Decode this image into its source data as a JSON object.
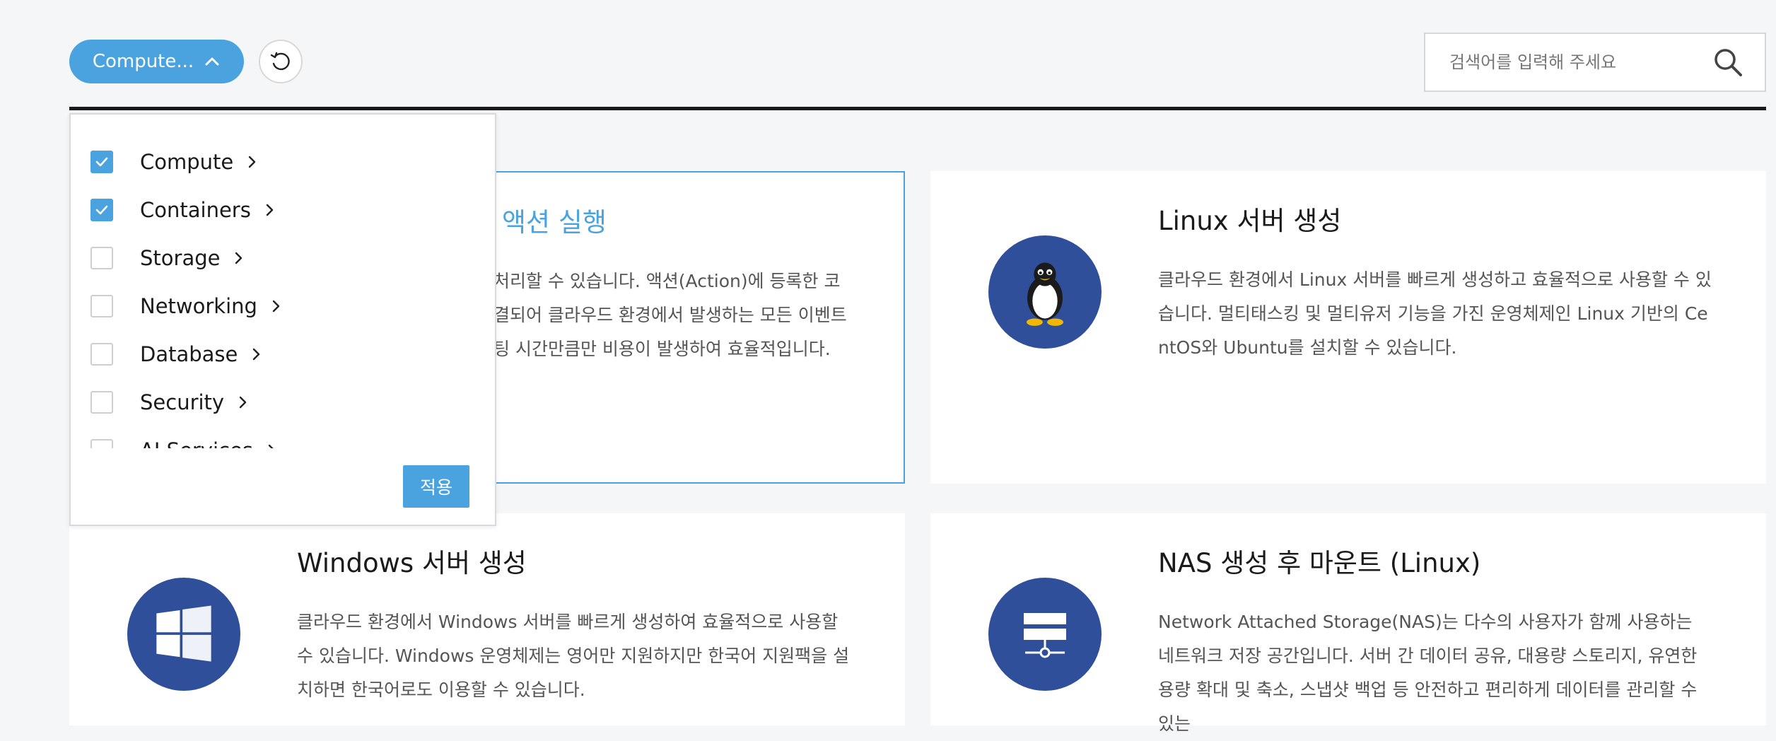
{
  "toolbar": {
    "filter_label": "Compute...",
    "search_placeholder": "검색어를 입력해 주세요"
  },
  "filter_dropdown": {
    "items": [
      {
        "label": "Compute",
        "checked": true
      },
      {
        "label": "Containers",
        "checked": true
      },
      {
        "label": "Storage",
        "checked": false
      },
      {
        "label": "Networking",
        "checked": false
      },
      {
        "label": "Database",
        "checked": false
      },
      {
        "label": "Security",
        "checked": false
      },
      {
        "label": "AI Services",
        "checked": false
      }
    ],
    "apply_label": "적용"
  },
  "cards": [
    {
      "title": "액션 실행",
      "desc": "처리할 수 있습니다. 액션(Action)에 등록한 코 결되어 클라우드 환경에서 발생하는 모든 이벤트 팅 시간만큼만 비용이 발생하여 효율적입니다."
    },
    {
      "title": "Linux 서버 생성",
      "desc": "클라우드 환경에서 Linux 서버를 빠르게 생성하고 효율적으로 사용할 수 있습니다. 멀티태스킹 및 멀티유저 기능을 가진 운영체제인 Linux 기반의 CentOS와 Ubuntu를 설치할 수 있습니다.",
      "icon": "linux-penguin-icon"
    },
    {
      "title": "Windows 서버 생성",
      "desc": "클라우드 환경에서 Windows 서버를 빠르게 생성하여 효율적으로 사용할 수 있습니다. Windows 운영체제는 영어만 지원하지만 한국어 지원팩을 설치하면 한국어로도 이용할 수 있습니다.",
      "icon": "windows-logo-icon"
    },
    {
      "title": "NAS 생성 후 마운트 (Linux)",
      "desc": "Network Attached Storage(NAS)는 다수의 사용자가 함께 사용하는 네트워크 저장 공간입니다. 서버 간 데이터 공유, 대용량 스토리지, 유연한 용량 확대 및 축소, 스냅샷 백업 등 안전하고 편리하게 데이터를 관리할 수 있는",
      "icon": "nas-storage-icon"
    }
  ],
  "colors": {
    "accent": "#4aa3df",
    "icon_bg": "#2f4f9a"
  }
}
